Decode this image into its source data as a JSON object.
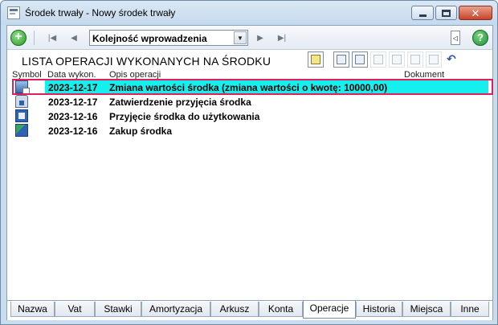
{
  "window": {
    "title": "Środek trwały - Nowy środek trwały",
    "icons": {
      "minimize": "minimize-icon",
      "maximize": "maximize-icon",
      "close": "close-icon"
    }
  },
  "toolbar": {
    "add_icon": "plus-icon",
    "help_icon": "question-icon",
    "sort_selected": "Kolejność wprowadzenia",
    "nav_icons": [
      "first-icon",
      "prev-icon",
      "next-icon",
      "last-icon"
    ],
    "collapse_icon": "triangle-left-icon"
  },
  "list": {
    "title": "LISTA OPERACJI WYKONANYCH NA ŚRODKU",
    "operation_icons": [
      "view-icon",
      "calendar-icon",
      "insert-icon",
      "document-icon",
      "edit-icon",
      "export-icon",
      "delete-icon",
      "undo-icon"
    ],
    "columns": {
      "symbol": "Symbol",
      "date": "Data wykon.",
      "description": "Opis operacji",
      "document": "Dokument"
    },
    "rows": [
      {
        "date": "2023-12-17",
        "description": "Zmiana wartości środka (zmiana wartości o kwotę: 10000,00)",
        "icon": "value-change-icon",
        "selected": true
      },
      {
        "date": "2023-12-17",
        "description": "Zatwierdzenie przyjęcia środka",
        "icon": "lock-icon",
        "selected": false
      },
      {
        "date": "2023-12-16",
        "description": "Przyjęcie środka do użytkowania",
        "icon": "monitor-icon",
        "selected": false
      },
      {
        "date": "2023-12-16",
        "description": "Zakup środka",
        "icon": "purchase-icon",
        "selected": false
      }
    ]
  },
  "tabs": [
    {
      "label": "Nazwa",
      "active": false
    },
    {
      "label": "Vat",
      "active": false
    },
    {
      "label": "Stawki",
      "active": false
    },
    {
      "label": "Amortyzacja",
      "active": false
    },
    {
      "label": "Arkusz",
      "active": false
    },
    {
      "label": "Konta",
      "active": false
    },
    {
      "label": "Operacje",
      "active": true
    },
    {
      "label": "Historia",
      "active": false
    },
    {
      "label": "Miejsca",
      "active": false
    },
    {
      "label": "Inne",
      "active": false
    }
  ],
  "colors": {
    "selection": "#15f0ee",
    "selection_frame": "#e0205a"
  }
}
